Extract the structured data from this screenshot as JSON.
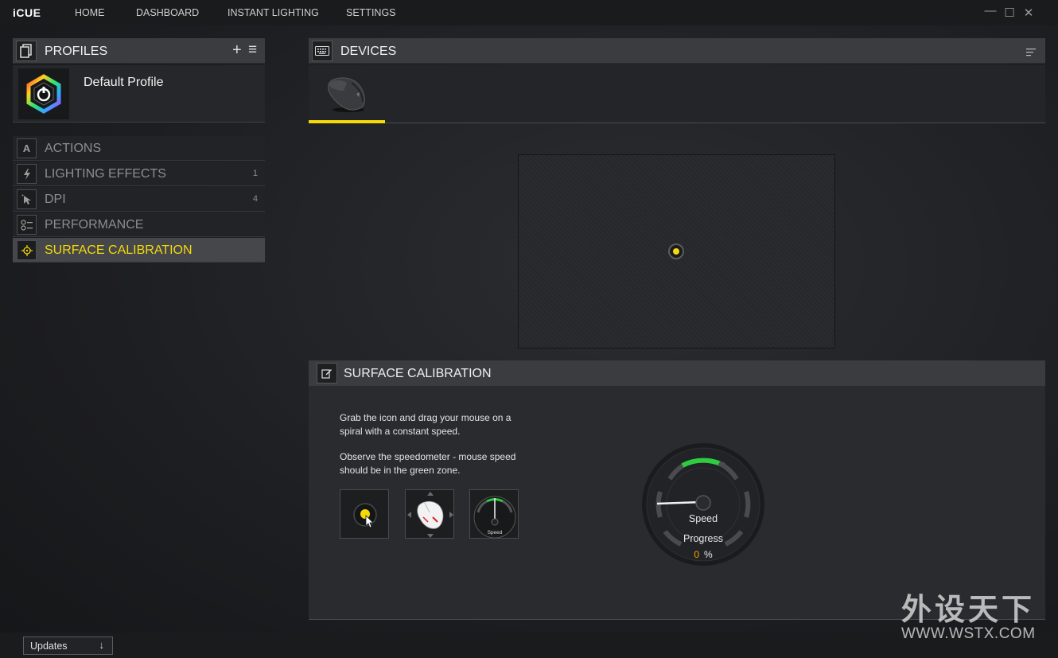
{
  "app": {
    "title": "iCUE"
  },
  "nav": {
    "home": "HOME",
    "dashboard": "DASHBOARD",
    "instant_lighting": "INSTANT LIGHTING",
    "settings": "SETTINGS"
  },
  "window_controls": {
    "minimize": "—",
    "maximize": "☐",
    "close": "✕"
  },
  "profiles": {
    "header": "PROFILES",
    "add": "+",
    "menu": "≡",
    "current": "Default Profile"
  },
  "menu": {
    "items": [
      {
        "label": "ACTIONS",
        "count": "",
        "icon": "actions-icon"
      },
      {
        "label": "LIGHTING EFFECTS",
        "count": "1",
        "icon": "lightning-icon"
      },
      {
        "label": "DPI",
        "count": "4",
        "icon": "dpi-cursor-icon"
      },
      {
        "label": "PERFORMANCE",
        "count": "",
        "icon": "performance-icon"
      },
      {
        "label": "SURFACE CALIBRATION",
        "count": "",
        "icon": "crosshair-icon",
        "active": true
      }
    ]
  },
  "devices": {
    "header": "DEVICES",
    "selected": "mouse"
  },
  "calibration": {
    "header": "SURFACE CALIBRATION",
    "instruction_1": "Grab the icon and drag your mouse on a spiral with a constant speed.",
    "instruction_2": "Observe the speedometer - mouse speed should be in the green zone.",
    "step3_label": "Speed",
    "gauge_label": "Speed",
    "progress_label": "Progress",
    "progress_value": "0",
    "progress_unit": "%"
  },
  "footer": {
    "updates": "Updates",
    "updates_icon": "↓"
  },
  "watermark": {
    "cn": "外设天下",
    "en": "WWW.WSTX.COM"
  },
  "colors": {
    "accent": "#f5d90a",
    "progress": "#f5a500",
    "green_zone": "#2ecc40"
  }
}
